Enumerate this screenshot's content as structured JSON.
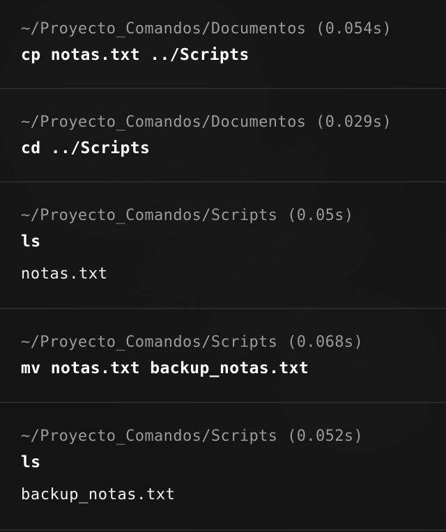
{
  "blocks": [
    {
      "prompt": "~/Proyecto_Comandos/Documentos (0.054s)",
      "command": "cp notas.txt ../Scripts",
      "output": ""
    },
    {
      "prompt": "~/Proyecto_Comandos/Documentos (0.029s)",
      "command": "cd ../Scripts",
      "output": ""
    },
    {
      "prompt": "~/Proyecto_Comandos/Scripts (0.05s)",
      "command": "ls",
      "output": "notas.txt"
    },
    {
      "prompt": "~/Proyecto_Comandos/Scripts (0.068s)",
      "command": "mv notas.txt backup_notas.txt",
      "output": ""
    },
    {
      "prompt": "~/Proyecto_Comandos/Scripts (0.052s)",
      "command": "ls",
      "output": "backup_notas.txt"
    }
  ],
  "colors": {
    "background": "#141414",
    "prompt_text": "#9a9a9a",
    "command_text": "#ffffff",
    "divider": "#2a2a2a"
  }
}
